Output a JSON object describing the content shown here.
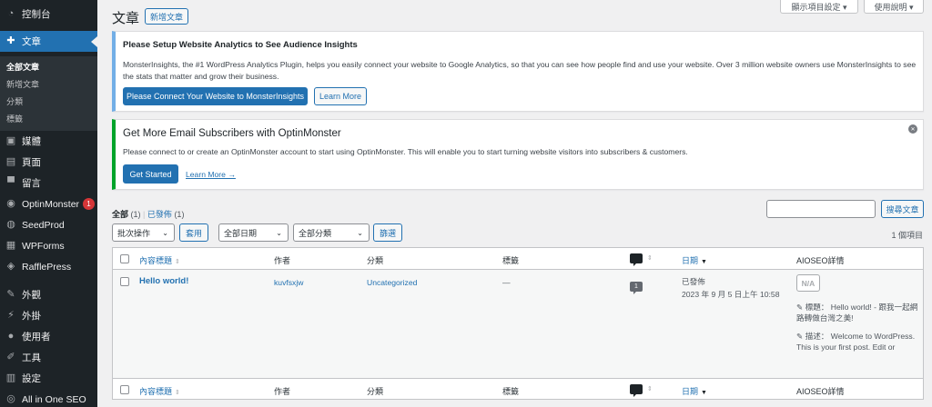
{
  "sidebar": {
    "items": [
      {
        "label": "控制台",
        "icon": "dashboard-icon",
        "glyph": "◔"
      },
      {
        "label": "文章",
        "icon": "pin-icon",
        "glyph": "📌"
      },
      {
        "label": "媒體",
        "icon": "media-icon",
        "glyph": "▣"
      },
      {
        "label": "頁面",
        "icon": "page-icon",
        "glyph": "▤"
      },
      {
        "label": "留言",
        "icon": "comment-icon",
        "glyph": "▀"
      },
      {
        "label": "OptinMonster",
        "icon": "optinmonster-icon",
        "glyph": "◉",
        "badge": "1"
      },
      {
        "label": "SeedProd",
        "icon": "seedprod-icon",
        "glyph": "◍"
      },
      {
        "label": "WPForms",
        "icon": "wpforms-icon",
        "glyph": "▦"
      },
      {
        "label": "RafflePress",
        "icon": "rafflepress-icon",
        "glyph": "◈"
      },
      {
        "label": "外觀",
        "icon": "appearance-icon",
        "glyph": "✎"
      },
      {
        "label": "外掛",
        "icon": "plugin-icon",
        "glyph": "⚡"
      },
      {
        "label": "使用者",
        "icon": "user-icon",
        "glyph": "●"
      },
      {
        "label": "工具",
        "icon": "wrench-icon",
        "glyph": "✐"
      },
      {
        "label": "設定",
        "icon": "settings-icon",
        "glyph": "▥"
      },
      {
        "label": "All in One SEO",
        "icon": "aioseo-icon",
        "glyph": "◎"
      }
    ],
    "submenu": [
      "全部文章",
      "新增文章",
      "分類",
      "標籤"
    ]
  },
  "header": {
    "title": "文章",
    "add_new": "新增文章",
    "screen_options": "顯示項目設定 ▾",
    "help": "使用說明 ▾"
  },
  "notice_monsterinsights": {
    "title": "Please Setup Website Analytics to See Audience Insights",
    "body": "MonsterInsights, the #1 WordPress Analytics Plugin, helps you easily connect your website to Google Analytics, so that you can see how people find and use your website. Over 3 million website owners use MonsterInsights to see the stats that matter and grow their business.",
    "primary": "Please Connect Your Website to MonsterInsights",
    "secondary": "Learn More"
  },
  "notice_optinmonster": {
    "title": "Get More Email Subscribers with OptinMonster",
    "body": "Please connect to or create an OptinMonster account to start using OptinMonster. This will enable you to start turning website visitors into subscribers & customers.",
    "primary": "Get Started",
    "link": "Learn More →",
    "close": "✕"
  },
  "filters": {
    "all": "全部",
    "all_count": "(1)",
    "sep": "|",
    "published": "已發佈",
    "published_count": "(1)",
    "bulk": "批次操作",
    "apply": "套用",
    "dates": "全部日期",
    "cats": "全部分類",
    "filter": "篩選",
    "search_button": "搜尋文章",
    "items": "1 個項目"
  },
  "table": {
    "headers": {
      "title": "內容標題",
      "author": "作者",
      "categories": "分類",
      "tags": "標籤",
      "date": "日期",
      "aioseo": "AIOSEO詳情"
    },
    "row": {
      "title": "Hello world!",
      "author": "kuvfsxjw",
      "category": "Uncategorized",
      "tags": "—",
      "comments": "1",
      "status": "已發佈",
      "date": "2023 年 9 月 5 日上午 10:58",
      "seo_score": "N/A",
      "seo_title_label": "標題：",
      "seo_title": "Hello world! - 跟我一起網路轉做台灣之美!",
      "seo_desc_label": "描述：",
      "seo_desc": "Welcome to WordPress. This is your first post. Edit or"
    }
  },
  "colors": {
    "sidebar_bg": "#1d2327",
    "accent": "#2271b1",
    "notice_blue": "#72aee6",
    "notice_green": "#00a32a",
    "badge_red": "#d63638"
  }
}
